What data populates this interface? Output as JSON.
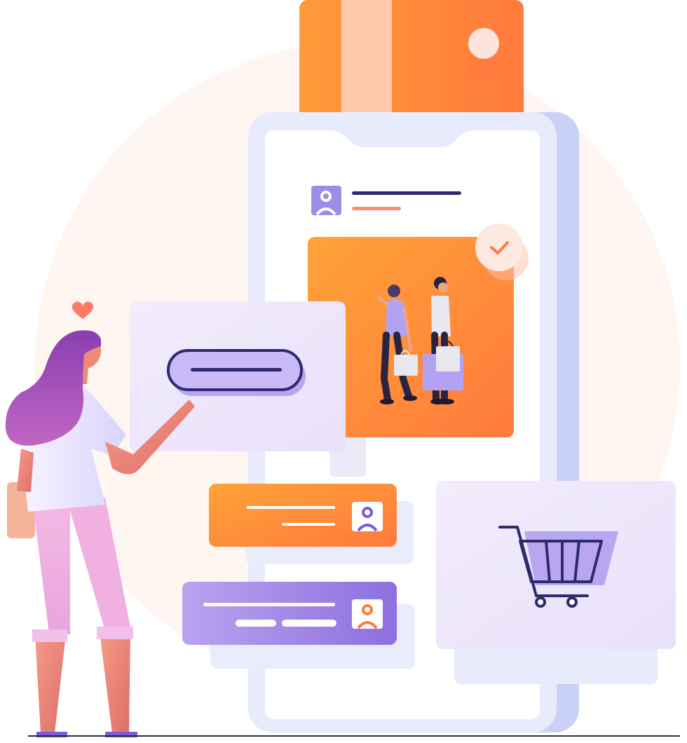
{
  "scene": {
    "description_free": true
  },
  "colors": {
    "background": "#ffffff",
    "background_blob": "#fff6f1",
    "phone_frame": "#e7ebfb",
    "phone_frame_shadow": "#c9d2f6",
    "phone_screen": "#ffffff",
    "card_orange_start": "#ffa238",
    "card_orange_end": "#ff7a3d",
    "card_stripe": "#ffd2c0",
    "purple_dark": "#2d2a6e",
    "purple_mid": "#7b5cd6",
    "purple_light": "#c5b4f3",
    "lavender_panel": "#efe8fb",
    "salmon": "#ff8b72",
    "heart": "#ff7a67",
    "check_badge": "#fde8e2",
    "hair_purple": "#9c4fb8",
    "skin": "#ef8a78"
  },
  "icons": {
    "profile_top": "user-avatar-icon",
    "check_badge": "check-icon",
    "cart": "shopping-cart-icon",
    "heart": "heart-icon",
    "profile_orange_card": "user-avatar-icon",
    "profile_purple_card": "user-avatar-icon",
    "credit_card": "credit-card-icon"
  }
}
